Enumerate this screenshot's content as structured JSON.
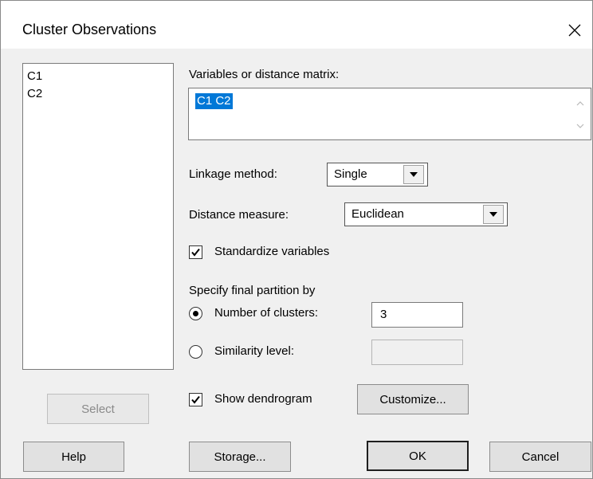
{
  "window": {
    "title": "Cluster Observations"
  },
  "variable_list": {
    "items": [
      "C1",
      "C2"
    ]
  },
  "variables": {
    "label": "Variables or distance matrix:",
    "value": "C1 C2"
  },
  "linkage": {
    "label": "Linkage method:",
    "value": "Single"
  },
  "distance": {
    "label": "Distance measure:",
    "value": "Euclidean"
  },
  "standardize": {
    "label": "Standardize variables",
    "checked": true
  },
  "partition": {
    "heading": "Specify final partition by",
    "clusters_label": "Number of clusters:",
    "clusters_value": "3",
    "clusters_selected": true,
    "similarity_label": "Similarity level:",
    "similarity_value": ""
  },
  "dendrogram": {
    "label": "Show dendrogram",
    "checked": true,
    "customize_label": "Customize..."
  },
  "buttons": {
    "select": "Select",
    "help": "Help",
    "storage": "Storage...",
    "ok": "OK",
    "cancel": "Cancel"
  }
}
